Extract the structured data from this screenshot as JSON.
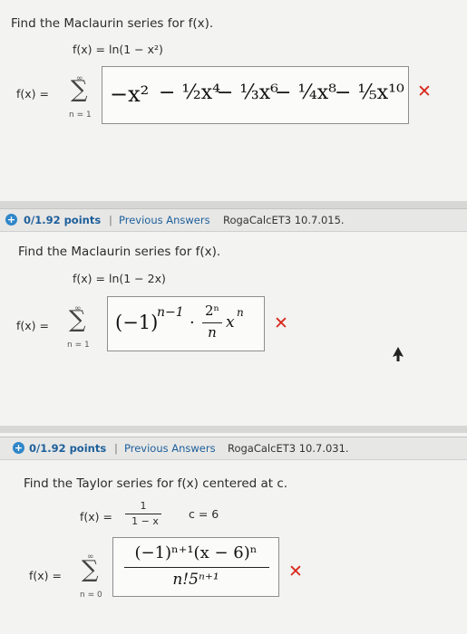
{
  "problems": [
    {
      "prompt": "Find the Maclaurin series for f(x).",
      "function": "f(x) = ln(1 − x²)",
      "lhs": "f(x) =",
      "sum_top": "∞",
      "sum_bottom": "n = 1",
      "answer_terms": [
        "−x²",
        "− ½x⁴",
        "− ⅓x⁶",
        "− ¼x⁸",
        "− ⅕x¹⁰"
      ],
      "result_icon": "x-mark-icon"
    },
    {
      "points": "0/1.92 points",
      "separator": "|",
      "previous_answers": "Previous Answers",
      "source": "RogaCalcET3 10.7.015.",
      "prompt": "Find the Maclaurin series for f(x).",
      "function": "f(x) = ln(1 − 2x)",
      "lhs": "f(x) =",
      "sum_top": "∞",
      "sum_bottom": "n = 1",
      "answer": {
        "sign": "(−1)",
        "exp": "n−1",
        "dot": "·",
        "num": "2ⁿ",
        "den": "n",
        "var": "x",
        "var_exp": "n"
      },
      "result_icon": "x-mark-icon"
    },
    {
      "points": "0/1.92 points",
      "separator": "|",
      "previous_answers": "Previous Answers",
      "source": "RogaCalcET3 10.7.031.",
      "prompt": "Find the Taylor series for f(x) centered at c.",
      "function_lhs": "f(x) =",
      "function_num": "1",
      "function_den": "1 − x",
      "function_center": "c = 6",
      "lhs": "f(x) =",
      "sum_top": "∞",
      "sum_bottom": "n = 0",
      "answer": {
        "num": "(−1)ⁿ⁺¹(x − 6)ⁿ",
        "den": "n!5ⁿ⁺¹"
      },
      "result_icon": "x-mark-icon"
    }
  ],
  "colors": {
    "error": "#d9281c",
    "accent": "#1d5f9a",
    "panel": "#f3f3f1"
  }
}
